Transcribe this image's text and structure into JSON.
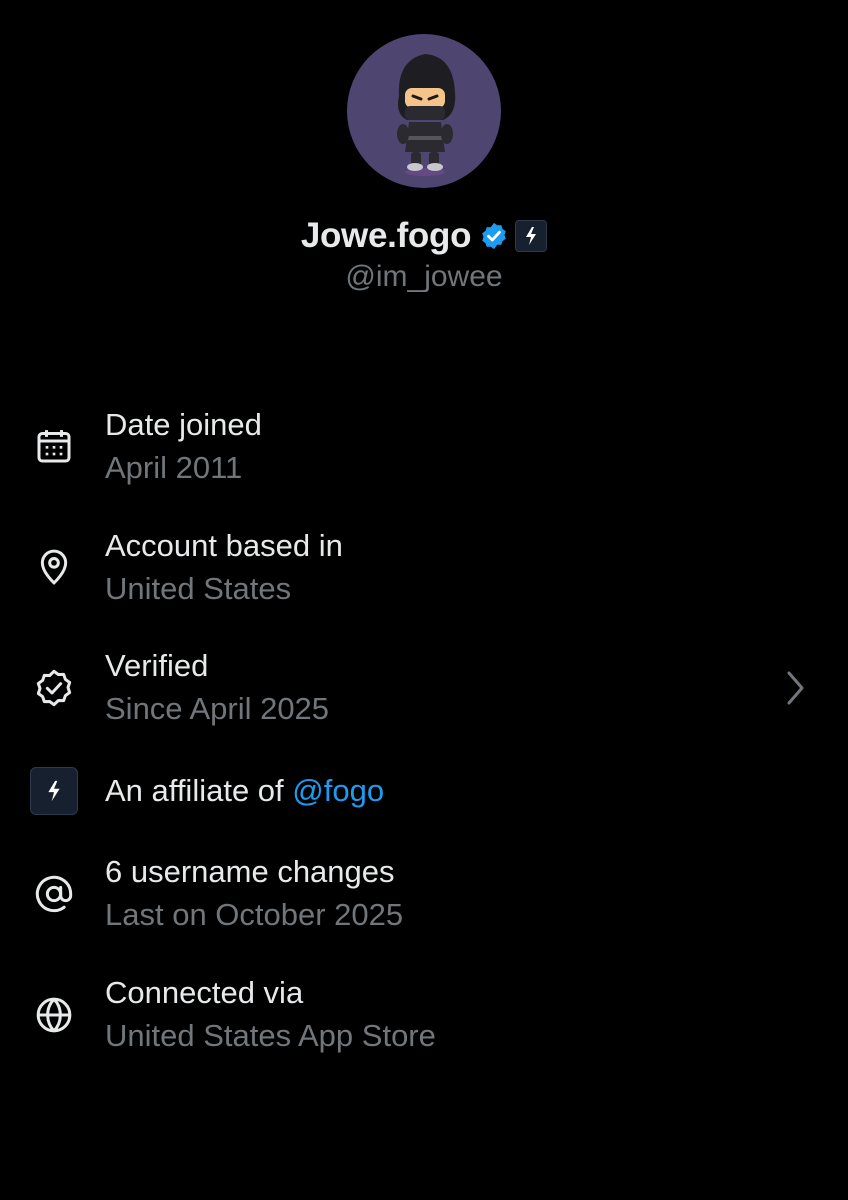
{
  "profile": {
    "display_name": "Jowe.fogo",
    "handle": "@im_jowee",
    "avatar_icon": "ninja-avatar",
    "verified_icon": "verified-badge-icon",
    "affiliate_icon": "fogo-affiliate-icon"
  },
  "colors": {
    "background": "#000000",
    "primary_text": "#e7e9ea",
    "secondary_text": "#71767b",
    "accent": "#1d9bf0",
    "avatar_bg": "#4e4670"
  },
  "rows": [
    {
      "icon": "calendar-icon",
      "title": "Date joined",
      "subtitle": "April 2011"
    },
    {
      "icon": "location-pin-icon",
      "title": "Account based in",
      "subtitle": "United States"
    },
    {
      "icon": "verified-check-icon",
      "title": "Verified",
      "subtitle": "Since April 2025",
      "chevron_icon": "chevron-right-icon"
    },
    {
      "icon": "fogo-affiliate-icon",
      "title_prefix": "An affiliate of ",
      "title_link": "@fogo"
    },
    {
      "icon": "at-sign-icon",
      "title": "6 username changes",
      "subtitle": "Last on October 2025"
    },
    {
      "icon": "globe-icon",
      "title": "Connected via",
      "subtitle": "United States App Store"
    }
  ]
}
